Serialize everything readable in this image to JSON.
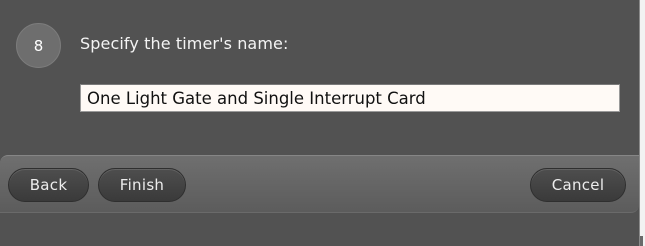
{
  "wizard": {
    "step_number": "8",
    "prompt": "Specify the timer's name:",
    "timer_name_value": "One Light Gate and Single Interrupt Card"
  },
  "buttons": {
    "back_label": "Back",
    "finish_label": "Finish",
    "cancel_label": "Cancel"
  },
  "colors": {
    "window_bg": "#525252",
    "button_bar_bg": "#666666",
    "button_bg": "#444444",
    "input_bg": "#fffaf6",
    "text_light": "#f4f4f4"
  }
}
